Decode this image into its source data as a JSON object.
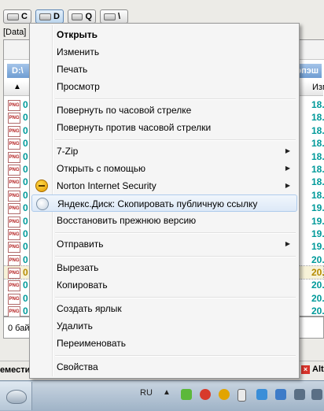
{
  "drives": [
    {
      "letter": "C",
      "active": false
    },
    {
      "letter": "D",
      "active": true
    },
    {
      "letter": "Q",
      "active": false
    },
    {
      "letter": "\\",
      "active": false
    }
  ],
  "path_label": "[Data]",
  "panel": {
    "path_prefix": "D:\\",
    "path_suffix": "эпэш",
    "col_right": "Изм",
    "sort_indicator": "▲"
  },
  "files": [
    {
      "name": "0",
      "date": "18.0",
      "selected": false
    },
    {
      "name": "0",
      "date": "18.0",
      "selected": false
    },
    {
      "name": "0",
      "date": "18.0",
      "selected": false
    },
    {
      "name": "0",
      "date": "18.0",
      "selected": false
    },
    {
      "name": "0",
      "date": "18.0",
      "selected": false
    },
    {
      "name": "0",
      "date": "18.0",
      "selected": false
    },
    {
      "name": "0",
      "date": "18.0",
      "selected": false
    },
    {
      "name": "0",
      "date": "18.0",
      "selected": false
    },
    {
      "name": "0",
      "date": "19.0",
      "selected": false
    },
    {
      "name": "0",
      "date": "19.0",
      "selected": false
    },
    {
      "name": "0",
      "date": "19.0",
      "selected": false
    },
    {
      "name": "0",
      "date": "19.0",
      "selected": false
    },
    {
      "name": "0",
      "date": "20.0",
      "selected": false
    },
    {
      "name": "0",
      "date": "20.0",
      "selected": true
    },
    {
      "name": "0",
      "date": "20.0",
      "selected": false
    },
    {
      "name": "0",
      "date": "20.0",
      "selected": false
    },
    {
      "name": "0",
      "date": "20.0",
      "selected": false
    },
    {
      "name": "0",
      "date": "20.0",
      "selected": false
    }
  ],
  "file_icon_text": "PNG",
  "status_text": "0 бай",
  "cmdbar": {
    "left": "еместит",
    "right": "Alt"
  },
  "taskbar": {
    "lang": "RU",
    "tray_arrow": "▲"
  },
  "menu": {
    "open": "Открыть",
    "edit": "Изменить",
    "print": "Печать",
    "preview": "Просмотр",
    "rotate_cw": "Повернуть по часовой стрелке",
    "rotate_ccw": "Повернуть против часовой стрелки",
    "zip": "7-Zip",
    "open_with": "Открыть с помощью",
    "norton": "Norton Internet Security",
    "yandex": "Яндекс.Диск: Скопировать публичную ссылку",
    "restore": "Восстановить прежнюю версию",
    "send_to": "Отправить",
    "cut": "Вырезать",
    "copy": "Копировать",
    "shortcut": "Создать ярлык",
    "delete": "Удалить",
    "rename": "Переименовать",
    "properties": "Свойства",
    "submenu_arrow": "▶"
  },
  "colors": {
    "accent_teal": "#009a9a",
    "selected_gold": "#b58b00",
    "menu_hover": "#dde9f7"
  }
}
